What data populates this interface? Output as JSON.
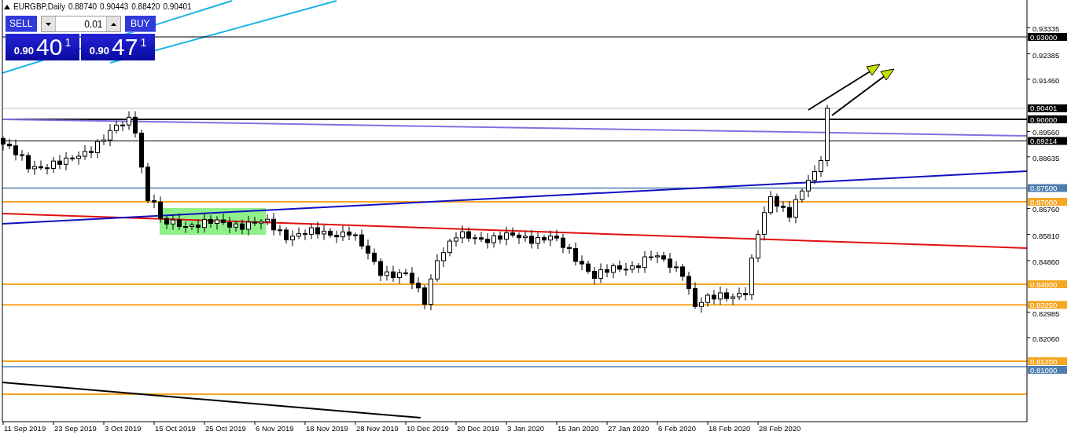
{
  "header": {
    "title": "EURGBP,Daily",
    "ohlc": [
      "0.88740",
      "0.90443",
      "0.88420",
      "0.90401"
    ]
  },
  "trade_panel": {
    "sell_label": "SELL",
    "buy_label": "BUY",
    "lot_value": "0.01",
    "sell_price": {
      "prefix": "0.90",
      "big": "40",
      "sup": "1"
    },
    "buy_price": {
      "prefix": "0.90",
      "big": "47",
      "sup": "1"
    }
  },
  "price_axis": {
    "ticks": [
      "0.93335",
      "0.92385",
      "0.91460",
      "0.89560",
      "0.88635",
      "0.86760",
      "0.85810",
      "0.84860",
      "0.82985",
      "0.82060"
    ],
    "price_labels": [
      {
        "label": "0.93000",
        "color": "#000000"
      },
      {
        "label": "0.90401",
        "color": "#000000"
      },
      {
        "label": "0.90000",
        "color": "#000000"
      },
      {
        "label": "0.89214",
        "color": "#000000"
      },
      {
        "label": "0.87500",
        "color": "#4f7fb0"
      },
      {
        "label": "0.87000",
        "color": "#f5a623"
      },
      {
        "label": "0.84000",
        "color": "#f5a623"
      },
      {
        "label": "0.83250",
        "color": "#f5a623"
      },
      {
        "label": "0.81200",
        "color": "#f5a623"
      },
      {
        "label": "0.81000",
        "color": "#4f7fb0"
      }
    ]
  },
  "time_axis": {
    "labels": [
      "11 Sep 2019",
      "23 Sep 2019",
      "3 Oct 2019",
      "15 Oct 2019",
      "25 Oct 2019",
      "6 Nov 2019",
      "18 Nov 2019",
      "28 Nov 2019",
      "10 Dec 2019",
      "20 Dec 2019",
      "3 Jan 2020",
      "15 Jan 2020",
      "27 Jan 2020",
      "6 Feb 2020",
      "18 Feb 2020",
      "28 Feb 2020"
    ]
  }
}
